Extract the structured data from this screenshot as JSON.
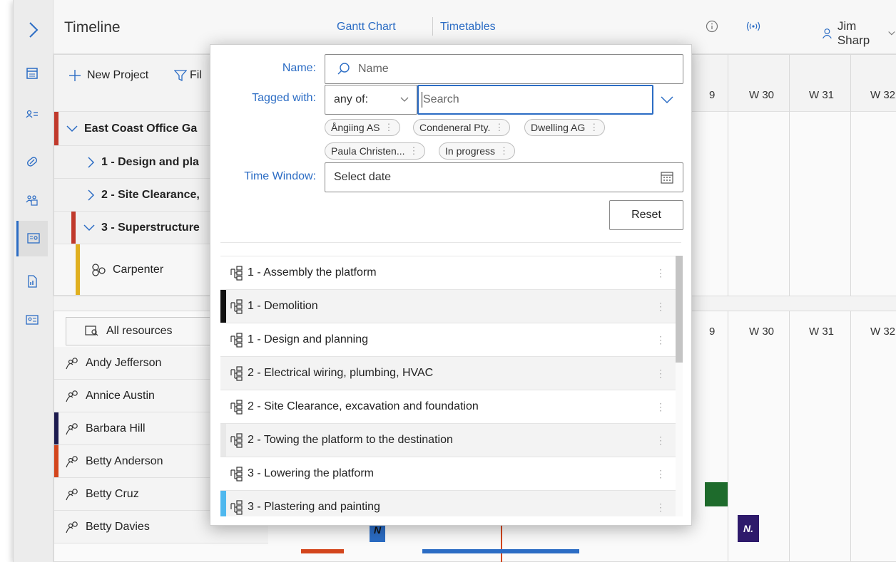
{
  "header": {
    "title": "Timeline",
    "nav": [
      "Gantt Chart",
      "Timetables"
    ],
    "user_name": "Jim Sharp"
  },
  "toolbar": {
    "new_project": "New Project",
    "filter": "Fil"
  },
  "projects": [
    {
      "label": "East Coast Office Ga",
      "expanded": true,
      "color": "#c0392b"
    },
    {
      "label": "1 - Design and pla",
      "expanded": false,
      "color": ""
    },
    {
      "label": "2 - Site Clearance,",
      "expanded": false,
      "color": ""
    },
    {
      "label": "3 - Superstructure",
      "expanded": true,
      "color": "#c0392b"
    },
    {
      "label": "Carpenter",
      "expanded": false,
      "color": "#e0b020"
    }
  ],
  "weeks": [
    "9",
    "W 30",
    "W 31",
    "W 32"
  ],
  "resources": {
    "header": "All resources",
    "items": [
      {
        "name": "Andy Jefferson",
        "color": ""
      },
      {
        "name": "Annice Austin",
        "color": ""
      },
      {
        "name": "Barbara Hill",
        "color": "#1c1a4e"
      },
      {
        "name": "Betty Anderson",
        "color": "#d3451c"
      },
      {
        "name": "Betty Cruz",
        "color": ""
      },
      {
        "name": "Betty Davies",
        "color": ""
      }
    ]
  },
  "filter": {
    "name_label": "Name:",
    "name_placeholder": "Name",
    "tagged_label": "Tagged with:",
    "tag_mode": "any of:",
    "tag_search_placeholder": "Search",
    "tags": [
      "Ångiing AS",
      "Condeneral Pty.",
      "Dwelling AG",
      "Paula Christen...",
      "In progress"
    ],
    "time_label": "Time Window:",
    "date_placeholder": "Select date",
    "reset_label": "Reset"
  },
  "results": [
    {
      "label": "1 - Assembly the platform",
      "color": ""
    },
    {
      "label": "1 - Demolition",
      "color": "#111111"
    },
    {
      "label": "1 - Design and planning",
      "color": ""
    },
    {
      "label": "2 - Electrical wiring, plumbing, HVAC",
      "color": ""
    },
    {
      "label": "2 - Site Clearance, excavation and foundation",
      "color": ""
    },
    {
      "label": "2 - Towing the platform to the destination",
      "color": "#e8e8e8"
    },
    {
      "label": "3 - Lowering the platform",
      "color": ""
    },
    {
      "label": "3 - Plastering and painting",
      "color": "#4fb8ee"
    }
  ],
  "gantt_chips": [
    "N",
    "N."
  ],
  "colors": {
    "accent": "#2b6cc4"
  }
}
